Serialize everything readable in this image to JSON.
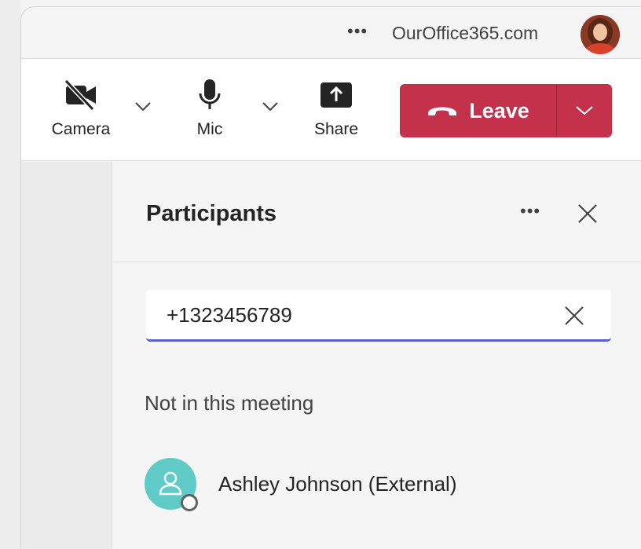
{
  "titlebar": {
    "more_label": "•••",
    "domain": "OurOffice365.com",
    "avatar_icon": "user-avatar-photo"
  },
  "toolbar": {
    "camera_label": "Camera",
    "mic_label": "Mic",
    "share_label": "Share",
    "leave_label": "Leave",
    "leave_color": "#c4314b"
  },
  "participants_panel": {
    "title": "Participants",
    "more_label": "•••",
    "search": {
      "value": "+1323456789",
      "accent_color": "#5b5fc7"
    },
    "section_label": "Not in this meeting",
    "people": [
      {
        "name": "Ashley Johnson (External)",
        "avatar_color": "#5fcac6",
        "status": "offline"
      }
    ]
  }
}
